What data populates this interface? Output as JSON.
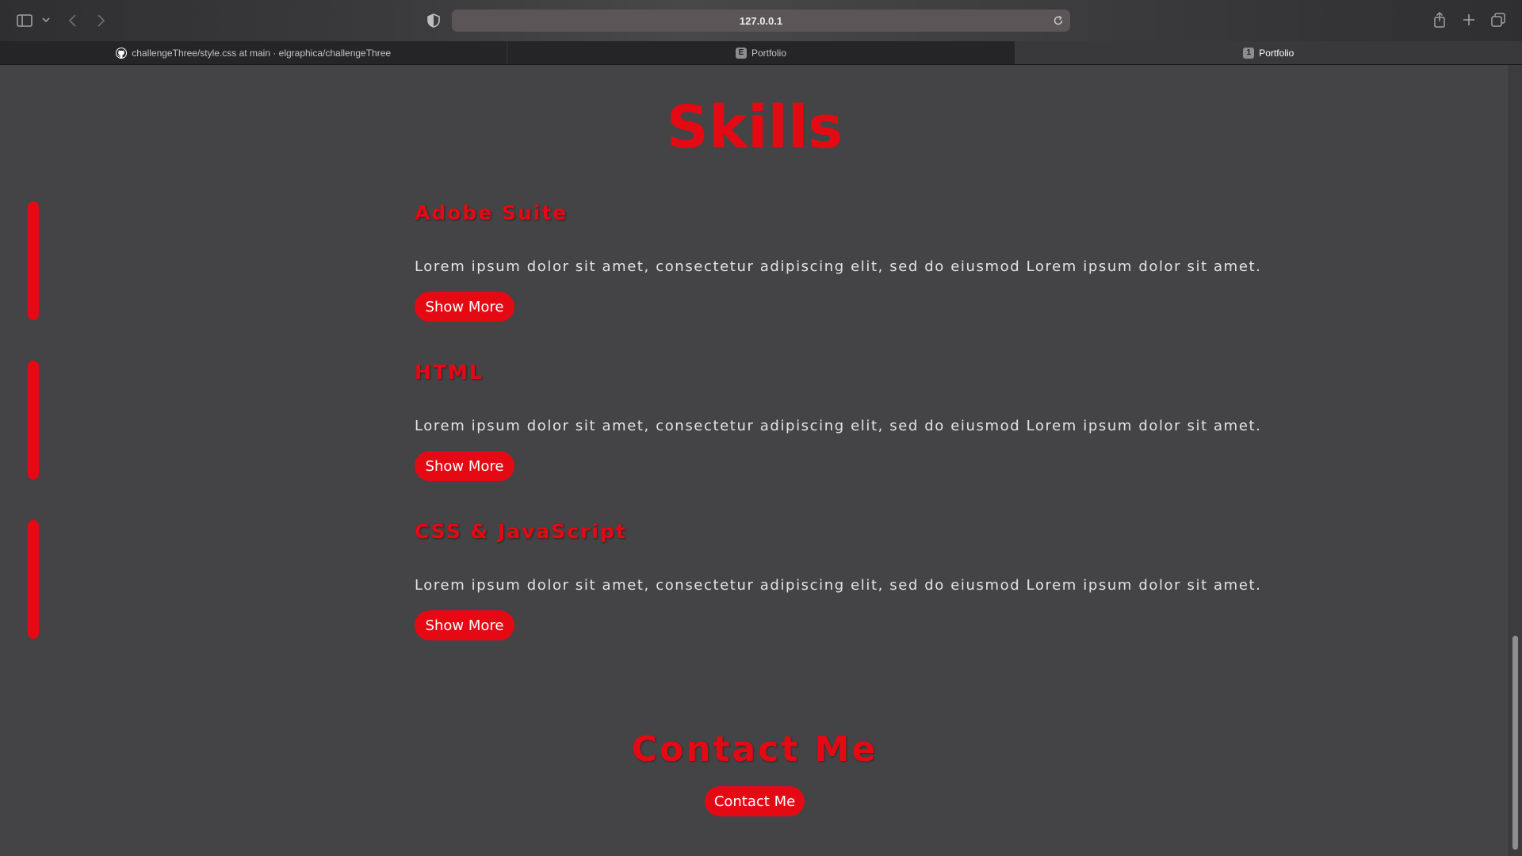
{
  "browser": {
    "url": "127.0.0.1",
    "tabs": [
      {
        "label": "challengeThree/style.css at main · elgraphica/challengeThree",
        "favicon": "github-icon",
        "active": false
      },
      {
        "label": "Portfolio",
        "favicon": "E",
        "active": false
      },
      {
        "label": "Portfolio",
        "favicon": "1",
        "active": true
      }
    ]
  },
  "page": {
    "title": "Skills",
    "accent_color": "#e50914",
    "background_color": "#444446",
    "skills": [
      {
        "title": "Adobe Suite",
        "text": "Lorem ipsum dolor sit amet, consectetur adipiscing elit, sed do eiusmod Lorem ipsum dolor sit amet.",
        "button": "Show More"
      },
      {
        "title": "HTML",
        "text": "Lorem ipsum dolor sit amet, consectetur adipiscing elit, sed do eiusmod Lorem ipsum dolor sit amet.",
        "button": "Show More"
      },
      {
        "title": "CSS & JavaScript",
        "text": "Lorem ipsum dolor sit amet, consectetur adipiscing elit, sed do eiusmod Lorem ipsum dolor sit amet.",
        "button": "Show More"
      }
    ],
    "contact": {
      "title": "Contact Me",
      "button": "Contact Me"
    }
  }
}
